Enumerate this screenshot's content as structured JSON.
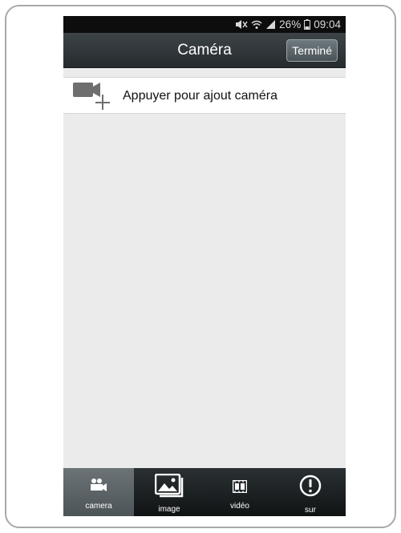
{
  "status_bar": {
    "battery": "26%",
    "time": "09:04",
    "icons": [
      "mute-icon",
      "wifi-icon",
      "signal-icon",
      "battery-icon"
    ]
  },
  "header": {
    "title": "Caméra",
    "done_label": "Terminé"
  },
  "add_camera": {
    "label": "Appuyer pour ajout caméra",
    "icon": "add-camera-icon"
  },
  "tabs": [
    {
      "label": "camera",
      "icon": "camera-icon",
      "active": true
    },
    {
      "label": "image",
      "icon": "image-icon",
      "active": false
    },
    {
      "label": "vidéo",
      "icon": "film-icon",
      "active": false
    },
    {
      "label": "sur",
      "icon": "info-icon",
      "active": false
    }
  ],
  "colors": {
    "status_bar": "#0d0d0d",
    "header": "#30363a",
    "content_bg": "#ebebeb",
    "tabbar": "#1a1e20",
    "active_tab": "#5d6568"
  }
}
